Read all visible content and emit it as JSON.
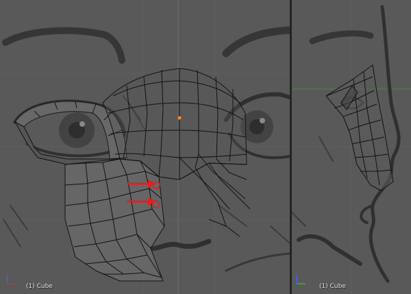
{
  "viewports": {
    "front": {
      "object_label": "(1) Cube",
      "view": "front-orthographic"
    },
    "side": {
      "object_label": "(1) Cube",
      "view": "right-orthographic"
    }
  },
  "annotations": {
    "arrow_color": "#e02020",
    "count": 2
  },
  "colors": {
    "viewport_bg": "#595959",
    "sketch_ink": "#303030",
    "mesh_wire": "#111111",
    "mesh_fill": "#666666",
    "selected_vertex": "#ff8c1a",
    "x_axis": "#c83232",
    "y_axis": "#32b432",
    "z_axis": "#3c64dc"
  }
}
